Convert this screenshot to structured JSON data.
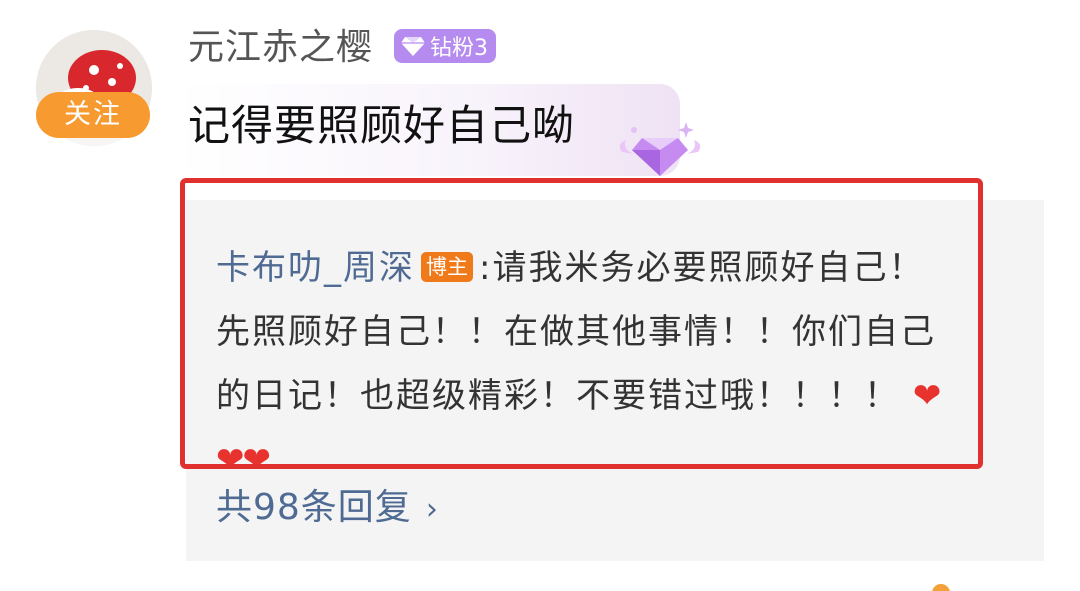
{
  "comment": {
    "username": "元江赤之樱",
    "fan_badge": "钻粉3",
    "follow_label": "关注",
    "text": "记得要照顾好自己呦"
  },
  "reply": {
    "author": "卡布叻_周深",
    "author_tag": "博主",
    "separator": ":",
    "text": "请我米务必要照顾好自己！先照顾好自己！！在做其他事情！！你们自己的日记！也超级精彩！不要错过哦！！！！",
    "emoji": "❤❤❤"
  },
  "more_replies": {
    "label": "共98条回复",
    "chevron": "›"
  },
  "colors": {
    "follow": "#f79a2f",
    "badge": "#b68bf0",
    "link": "#4f6b93",
    "highlight": "#e0312e",
    "panel": "#f4f4f4"
  }
}
